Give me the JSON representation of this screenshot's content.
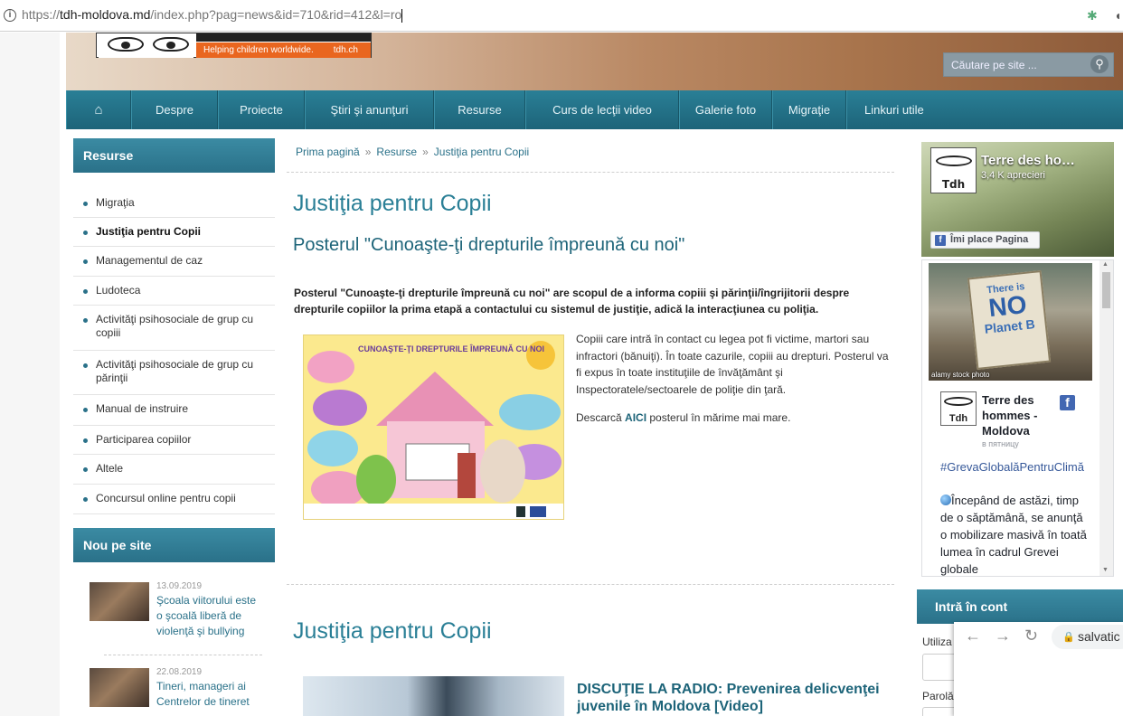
{
  "browser": {
    "url_prefix": "https://",
    "url_domain": "tdh-moldova.md",
    "url_path": "/index.php?pag=news&id=710&rid=412&l=ro"
  },
  "logo": {
    "tagline": "Helping children worldwide.",
    "site": "tdh.ch"
  },
  "search": {
    "placeholder": "Căutare pe site ..."
  },
  "nav": [
    "Despre",
    "Proiecte",
    "Ştiri şi anunţuri",
    "Resurse",
    "Curs de lecţii video",
    "Galerie foto",
    "Migraţie",
    "Linkuri utile"
  ],
  "sidebar": {
    "title": "Resurse",
    "items": [
      "Migraţia",
      "Justiţia pentru Copii",
      "Managementul de caz",
      "Ludoteca",
      "Activităţi psihosociale de grup cu copiii",
      "Activităţi psihosociale de grup cu părinţii",
      "Manual de instruire",
      "Participarea copiilor",
      "Altele",
      "Concursul online pentru copii"
    ],
    "active_index": 1
  },
  "new_on_site": {
    "title": "Nou pe site",
    "items": [
      {
        "date": "13.09.2019",
        "title": "Şcoala viitorului este o şcoală liberă de violenţă şi bullying"
      },
      {
        "date": "22.08.2019",
        "title": "Tineri, manageri ai Centrelor de tineret"
      }
    ]
  },
  "breadcrumb": [
    "Prima pagină",
    "Resurse",
    "Justiţia pentru Copii"
  ],
  "breadcrumb_sep": "»",
  "main": {
    "title": "Justiţia pentru Copii",
    "subtitle": "Posterul \"Cunoaşte-ţi drepturile împreună cu noi\"",
    "lead": "Posterul \"Cunoaşte-ţi drepturile împreună cu noi\" are scopul de a informa copiii şi părinţii/îngrijitorii despre drepturile copiilor la prima etapă a contactului cu sistemul de justiţie, adică la interacţiunea cu poliţia.",
    "paragraph": "Copiii care intră în contact cu legea pot fi victime, martori sau infractori (bănuiţi). În toate cazurile, copiii au drepturi. Posterul va fi expus în toate instituţiile de învăţământ şi Inspectoratele/sectoarele de poliţie din ţară.",
    "download_prefix": "Descarcă",
    "download_link": "AICI",
    "download_suffix": "posterul în mărime mai mare.",
    "poster_title": "CUNOAŞTE-ŢI DREPTURILE ÎMPREUNĂ CU NOI",
    "section2_title": "Justiţia pentru Copii",
    "article2_title": "DISCUŢIE LA RADIO: Prevenirea delicvenţei juvenile în Moldova [Video]"
  },
  "facebook": {
    "page_name": "Terre des ho…",
    "likes": "3,4 K aprecieri",
    "like_button": "Îmi place Pagina",
    "logo_text": "Tdh",
    "photo_sign": [
      "There is",
      "NO",
      "Planet B"
    ],
    "photo_credit": "alamy stock photo",
    "post_author": "Terre des hommes - Moldova",
    "post_time": "в пятницу",
    "post_tag": "#GrevaGlobalăPentruClimă",
    "post_text": "Începând de astăzi, timp de o săptămână, se anunţă o mobilizare masivă în toată lumea în cadrul Grevei globale"
  },
  "login": {
    "title": "Intră în cont",
    "user_label": "Utiliza",
    "pass_label": "Parolă"
  },
  "popup": {
    "domain": "salvatic"
  }
}
